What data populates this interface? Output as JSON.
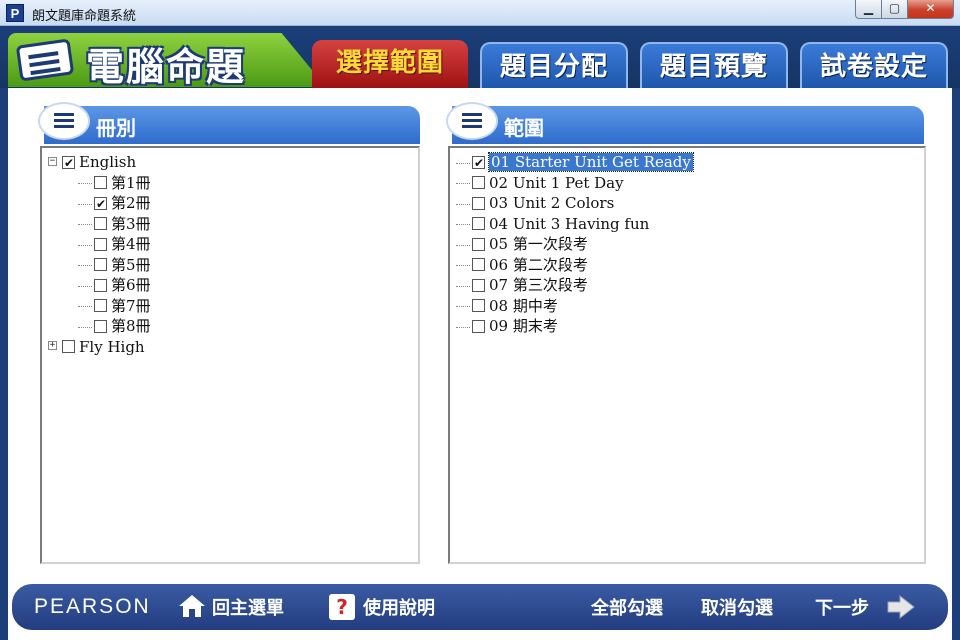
{
  "window": {
    "app_icon_letter": "P",
    "title": "朗文題庫命題系統",
    "min_glyph": "▁",
    "max_glyph": "▢",
    "close_glyph": "✕"
  },
  "header": {
    "brand_title": "電腦命題",
    "tabs": [
      {
        "label": "選擇範圍",
        "active": true
      },
      {
        "label": "題目分配",
        "active": false
      },
      {
        "label": "題目預覽",
        "active": false
      },
      {
        "label": "試卷設定",
        "active": false
      }
    ]
  },
  "left_panel": {
    "title": "冊別",
    "tree": [
      {
        "label": "English",
        "checked": true,
        "expanded": true,
        "toggle": "−",
        "children": [
          {
            "label": "第1冊",
            "checked": false
          },
          {
            "label": "第2冊",
            "checked": true
          },
          {
            "label": "第3冊",
            "checked": false
          },
          {
            "label": "第4冊",
            "checked": false
          },
          {
            "label": "第5冊",
            "checked": false
          },
          {
            "label": "第6冊",
            "checked": false
          },
          {
            "label": "第7冊",
            "checked": false
          },
          {
            "label": "第8冊",
            "checked": false
          }
        ]
      },
      {
        "label": "Fly High",
        "checked": false,
        "expanded": false,
        "toggle": "+"
      }
    ]
  },
  "right_panel": {
    "title": "範圍",
    "items": [
      {
        "label": "01  Starter Unit Get Ready",
        "checked": true,
        "selected": true
      },
      {
        "label": "02  Unit 1 Pet Day",
        "checked": false
      },
      {
        "label": "03  Unit 2 Colors",
        "checked": false
      },
      {
        "label": "04  Unit 3 Having fun",
        "checked": false
      },
      {
        "label": "05  第一次段考",
        "checked": false
      },
      {
        "label": "06  第二次段考",
        "checked": false
      },
      {
        "label": "07  第三次段考",
        "checked": false
      },
      {
        "label": "08  期中考",
        "checked": false
      },
      {
        "label": "09  期末考",
        "checked": false
      }
    ]
  },
  "bottom": {
    "logo": "PEARSON",
    "home_label": "回主選單",
    "help_label": "使用說明",
    "help_glyph": "?",
    "select_all_label": "全部勾選",
    "deselect_all_label": "取消勾選",
    "next_label": "下一步"
  },
  "colors": {
    "header_navy": "#1c3f7a",
    "brand_green": "#6cb82a",
    "active_tab_red": "#b71c1c",
    "active_tab_text": "#ffd83a",
    "tab_blue": "#2a66c0",
    "panel_header_blue": "#4a86da",
    "selection_blue": "#3a77d0"
  }
}
